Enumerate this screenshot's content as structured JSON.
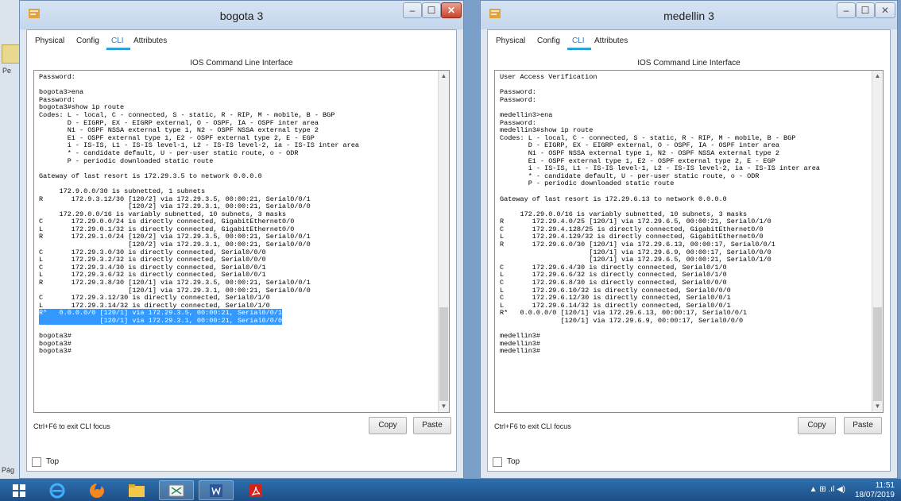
{
  "windows": [
    {
      "id": "bogota",
      "title": "bogota 3",
      "tabs": [
        "Physical",
        "Config",
        "CLI",
        "Attributes"
      ],
      "active_tab": "CLI",
      "cli_title": "IOS Command Line Interface",
      "terminal_before": "Password:\n\nbogota3>ena\nPassword:\nbogota3#show ip route\nCodes: L - local, C - connected, S - static, R - RIP, M - mobile, B - BGP\n       D - EIGRP, EX - EIGRP external, O - OSPF, IA - OSPF inter area\n       N1 - OSPF NSSA external type 1, N2 - OSPF NSSA external type 2\n       E1 - OSPF external type 1, E2 - OSPF external type 2, E - EGP\n       i - IS-IS, L1 - IS-IS level-1, L2 - IS-IS level-2, ia - IS-IS inter area\n       * - candidate default, U - per-user static route, o - ODR\n       P - periodic downloaded static route\n\nGateway of last resort is 172.29.3.5 to network 0.0.0.0\n\n     172.9.0.0/30 is subnetted, 1 subnets\nR       172.9.3.12/30 [120/2] via 172.29.3.5, 00:00:21, Serial0/0/1\n                      [120/2] via 172.29.3.1, 00:00:21, Serial0/0/0\n     172.29.0.0/16 is variably subnetted, 10 subnets, 3 masks\nC       172.29.0.0/24 is directly connected, GigabitEthernet0/0\nL       172.29.0.1/32 is directly connected, GigabitEthernet0/0\nR       172.29.1.0/24 [120/2] via 172.29.3.5, 00:00:21, Serial0/0/1\n                      [120/2] via 172.29.3.1, 00:00:21, Serial0/0/0\nC       172.29.3.0/30 is directly connected, Serial0/0/0\nL       172.29.3.2/32 is directly connected, Serial0/0/0\nC       172.29.3.4/30 is directly connected, Serial0/0/1\nL       172.29.3.6/32 is directly connected, Serial0/0/1\nR       172.29.3.8/30 [120/1] via 172.29.3.5, 00:00:21, Serial0/0/1\n                      [120/1] via 172.29.3.1, 00:00:21, Serial0/0/0\nC       172.29.3.12/30 is directly connected, Serial0/1/0\nL       172.29.3.14/32 is directly connected, Serial0/1/0",
      "terminal_highlight": "R*   0.0.0.0/0 [120/1] via 172.29.3.5, 00:00:21, Serial0/0/1\n               [120/1] via 172.29.3.1, 00:00:21, Serial0/0/0",
      "terminal_after": "\nbogota3#\nbogota3#\nbogota3#",
      "focus_hint": "Ctrl+F6 to exit CLI focus",
      "copy_label": "Copy",
      "paste_label": "Paste",
      "top_label": "Top"
    },
    {
      "id": "medellin",
      "title": "medellin 3",
      "tabs": [
        "Physical",
        "Config",
        "CLI",
        "Attributes"
      ],
      "active_tab": "CLI",
      "cli_title": "IOS Command Line Interface",
      "terminal_before": "User Access Verification\n\nPassword:\nPassword:\n\nmedellin3>ena\nPassword:\nmedellin3#show ip route\nCodes: L - local, C - connected, S - static, R - RIP, M - mobile, B - BGP\n       D - EIGRP, EX - EIGRP external, O - OSPF, IA - OSPF inter area\n       N1 - OSPF NSSA external type 1, N2 - OSPF NSSA external type 2\n       E1 - OSPF external type 1, E2 - OSPF external type 2, E - EGP\n       i - IS-IS, L1 - IS-IS level-1, L2 - IS-IS level-2, ia - IS-IS inter area\n       * - candidate default, U - per-user static route, o - ODR\n       P - periodic downloaded static route\n\nGateway of last resort is 172.29.6.13 to network 0.0.0.0\n\n     172.29.0.0/16 is variably subnetted, 10 subnets, 3 masks\nR       172.29.4.0/25 [120/1] via 172.29.6.5, 00:00:21, Serial0/1/0\nC       172.29.4.128/25 is directly connected, GigabitEthernet0/0\nL       172.29.4.129/32 is directly connected, GigabitEthernet0/0\nR       172.29.6.0/30 [120/1] via 172.29.6.13, 00:00:17, Serial0/0/1\n                      [120/1] via 172.29.6.9, 00:00:17, Serial0/0/0\n                      [120/1] via 172.29.6.5, 00:00:21, Serial0/1/0\nC       172.29.6.4/30 is directly connected, Serial0/1/0\nL       172.29.6.6/32 is directly connected, Serial0/1/0\nC       172.29.6.8/30 is directly connected, Serial0/0/0\nL       172.29.6.10/32 is directly connected, Serial0/0/0\nC       172.29.6.12/30 is directly connected, Serial0/0/1\nL       172.29.6.14/32 is directly connected, Serial0/0/1\nR*   0.0.0.0/0 [120/1] via 172.29.6.13, 00:00:17, Serial0/0/1\n               [120/1] via 172.29.6.9, 00:00:17, Serial0/0/0\n\nmedellin3#\nmedellin3#\nmedellin3#",
      "terminal_highlight": "",
      "terminal_after": "",
      "focus_hint": "Ctrl+F6 to exit CLI focus",
      "copy_label": "Copy",
      "paste_label": "Paste",
      "top_label": "Top"
    }
  ],
  "window_controls": {
    "minimize": "–",
    "maximize": "☐",
    "close": "✕"
  },
  "background": {
    "partial_label_top": "Pe",
    "partial_label_bottom": "Pág"
  },
  "taskbar": {
    "time": "11:51",
    "date": "18/07/2019",
    "tray_icons": "▲  ⊞  .ıl  ◀)"
  },
  "colors": {
    "accent": "#2ea1d8",
    "highlight": "#3399ff",
    "close": "#c9432d",
    "taskbar": "#1e4f87"
  }
}
